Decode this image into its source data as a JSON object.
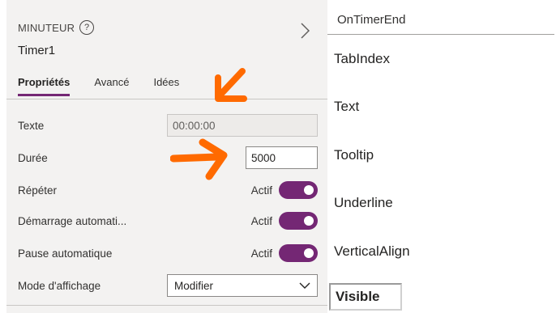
{
  "header": {
    "control_type": "MINUTEUR",
    "help_glyph": "?",
    "control_name": "Timer1"
  },
  "tabs": [
    {
      "label": "Propriétés",
      "active": true
    },
    {
      "label": "Avancé",
      "active": false
    },
    {
      "label": "Idées",
      "active": false
    }
  ],
  "properties": {
    "texte": {
      "label": "Texte",
      "value": "00:00:00"
    },
    "duree": {
      "label": "Durée",
      "value": "5000"
    },
    "repeter": {
      "label": "Répéter",
      "toggle_label": "Actif",
      "on": true
    },
    "demarrage": {
      "label": "Démarrage automati...",
      "toggle_label": "Actif",
      "on": true
    },
    "pause": {
      "label": "Pause automatique",
      "toggle_label": "Actif",
      "on": true
    },
    "mode": {
      "label": "Mode d'affichage",
      "value": "Modifier"
    }
  },
  "property_list": {
    "top": "OnTimerEnd",
    "items": [
      "TabIndex",
      "Text",
      "Tooltip",
      "Underline",
      "VerticalAlign"
    ],
    "highlighted": "Visible"
  },
  "colors": {
    "accent": "#742774",
    "annotation": "#ff6a00",
    "pane_bg": "#f3f2f1"
  },
  "icons": [
    "help-icon",
    "chevron-right-icon",
    "chevron-down-icon"
  ]
}
